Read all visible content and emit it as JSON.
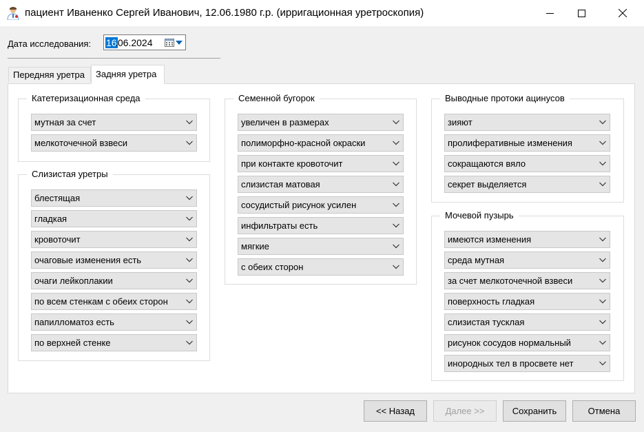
{
  "window": {
    "title": "пациент Иваненко Сергей Иванович, 12.06.1980 г.р. (ирригационная уретроскопия)"
  },
  "date": {
    "label": "Дата исследования:",
    "value_selected": "16",
    "value_rest": ".06.2024"
  },
  "tabs": [
    {
      "label": "Передняя уретра",
      "active": false
    },
    {
      "label": "Задняя уретра",
      "active": true
    }
  ],
  "groups": {
    "cath": {
      "title": "Катетеризационная среда",
      "items": [
        "мутная за счет",
        "мелкоточечной взвеси"
      ]
    },
    "mucosa": {
      "title": "Слизистая уретры",
      "items": [
        "блестящая",
        "гладкая",
        "кровоточит",
        "очаговые изменения есть",
        "очаги лейкоплакии",
        "по всем стенкам с обеих сторон",
        "папилломатоз есть",
        "по верхней стенке"
      ]
    },
    "tubercle": {
      "title": "Семенной бугорок",
      "items": [
        "увеличен в размерах",
        "полиморфно-красной окраски",
        "при контакте кровоточит",
        "слизистая матовая",
        "сосудистый рисунок усилен",
        "инфильтраты есть",
        "мягкие",
        "с обеих сторон"
      ]
    },
    "ducts": {
      "title": "Выводные протоки ацинусов",
      "items": [
        "зияют",
        "пролиферативные изменения",
        "сокращаются вяло",
        "секрет выделяется"
      ]
    },
    "bladder": {
      "title": "Мочевой пузырь",
      "items": [
        "имеются изменения",
        "среда мутная",
        "за счет мелкоточечной взвеси",
        "поверхность гладкая",
        "слизистая тусклая",
        "рисунок сосудов нормальный",
        "инородных тел в просвете нет"
      ]
    }
  },
  "buttons": {
    "back": "<< Назад",
    "next": "Далее >>",
    "save": "Сохранить",
    "cancel": "Отмена"
  },
  "colors": {
    "accent": "#0078d7",
    "dropdown_arrow": "#0063b1",
    "combo_bg": "#e5e5e5"
  },
  "icons": {
    "app": "doctor-icon",
    "calendar": "calendar-icon",
    "combo": "chevron-down-icon"
  }
}
